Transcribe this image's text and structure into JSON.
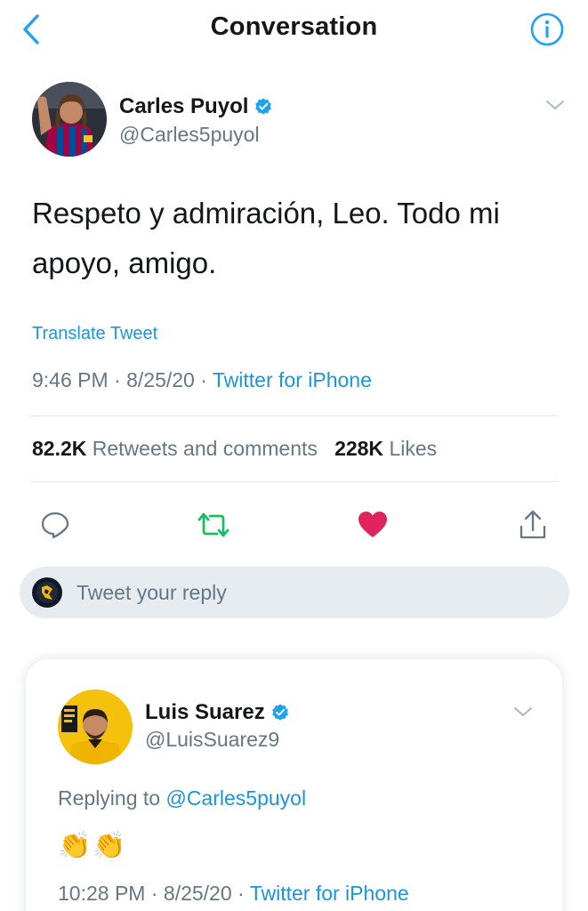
{
  "header": {
    "title": "Conversation",
    "back_icon": "chevron-left-icon",
    "info_icon": "info-icon"
  },
  "tweet": {
    "author_name": "Carles Puyol",
    "author_handle": "@Carles5puyol",
    "verified": true,
    "text": "Respeto y admiración, Leo. Todo mi apoyo, amigo.",
    "translate_label": "Translate Tweet",
    "time": "9:46 PM",
    "date": "8/25/20",
    "separator": "·",
    "source": "Twitter for iPhone",
    "retweets_count": "82.2K",
    "retweets_label": "Retweets and comments",
    "likes_count": "228K",
    "likes_label": "Likes"
  },
  "actions": {
    "reply_icon": "comment-icon",
    "retweet_icon": "retweet-icon",
    "like_icon": "heart-icon",
    "share_icon": "share-icon",
    "retweet_color": "#17bf63",
    "like_color": "#e0245e"
  },
  "reply_box": {
    "placeholder": "Tweet your reply"
  },
  "reply_tweet": {
    "author_name": "Luis Suarez",
    "author_handle": "@LuisSuarez9",
    "verified": true,
    "replying_prefix": "Replying to",
    "replying_to": "@Carles5puyol",
    "emojis": [
      "👏",
      "👏"
    ],
    "time": "10:28 PM",
    "date": "8/25/20",
    "separator": "·",
    "source": "Twitter for iPhone"
  },
  "colors": {
    "accent": "#1b95e0",
    "secondary_text": "#657786",
    "primary_text": "#14171a",
    "verified_badge": "#1da1f2",
    "reply_bar_bg": "#e6ecf0"
  }
}
